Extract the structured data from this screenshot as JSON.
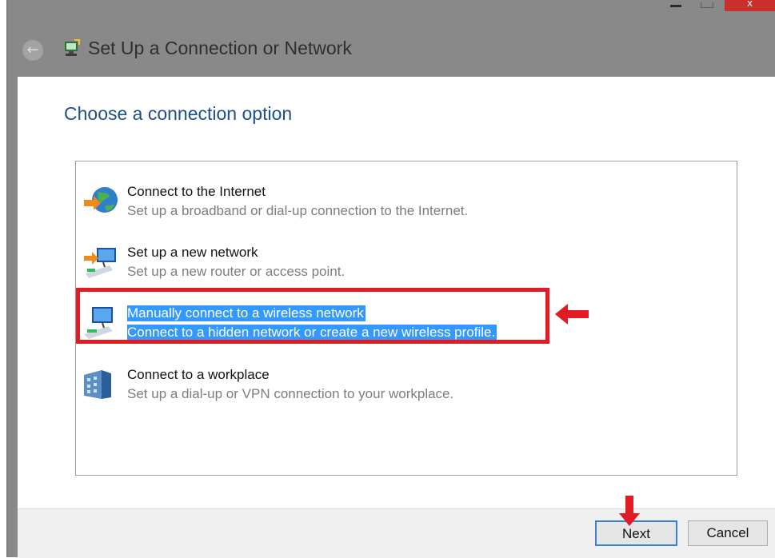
{
  "window": {
    "title": "Set Up a Connection or Network",
    "close_label": "x"
  },
  "main": {
    "heading": "Choose a connection option",
    "options": [
      {
        "title": "Connect to the Internet",
        "description": "Set up a broadband or dial-up connection to the Internet.",
        "icon": "globe-internet-icon"
      },
      {
        "title": "Set up a new network",
        "description": "Set up a new router or access point.",
        "icon": "router-icon"
      },
      {
        "title": "Manually connect to a wireless network",
        "description": "Connect to a hidden network or create a new wireless profile.",
        "icon": "wireless-network-icon",
        "selected": true
      },
      {
        "title": "Connect to a workplace",
        "description": "Set up a dial-up or VPN connection to your workplace.",
        "icon": "workplace-vpn-icon"
      }
    ]
  },
  "footer": {
    "next_label": "Next",
    "cancel_label": "Cancel"
  },
  "colors": {
    "heading": "#1e4f8c",
    "selection": "#3399ff",
    "annotation": "#e01b24"
  }
}
